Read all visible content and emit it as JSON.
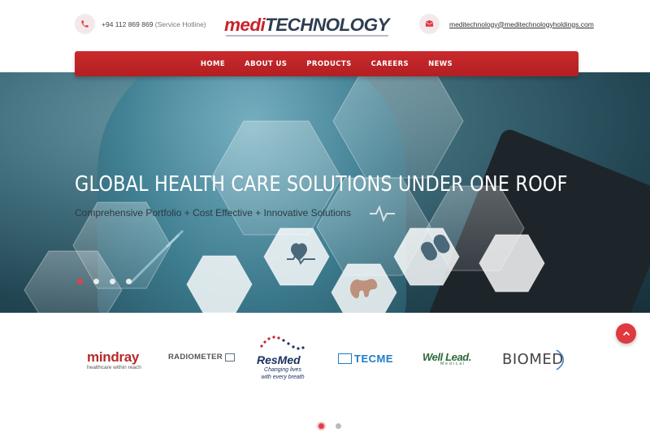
{
  "header": {
    "phone_number": "+94 112 869 869",
    "phone_note": "(Service Hotline)",
    "email": "meditechnology@meditechnologyholdings.com",
    "logo_part1": "medi",
    "logo_part2": "TECHNOLOGY"
  },
  "nav": {
    "items": [
      "HOME",
      "ABOUT US",
      "PRODUCTS",
      "CAREERS",
      "NEWS"
    ]
  },
  "hero": {
    "title": "GLOBAL HEALTH CARE SOLUTIONS UNDER ONE ROOF",
    "subtitle": "Comprehensive Portfolio + Cost Effective + Innovative Solutions",
    "slide_count": 4,
    "active_slide": 1
  },
  "brands": {
    "mindray_name": "mindray",
    "mindray_tagline": "healthcare within reach",
    "radiometer_name": "RADIOMETER",
    "resmed_name": "ResMed",
    "resmed_tagline_1": "Changing lives",
    "resmed_tagline_2": "with every breath",
    "tecme_name": "TECME",
    "welllead_name": "Well Lead.",
    "welllead_tagline": "Medical",
    "biomed_name": "BIOMED",
    "page_count": 2,
    "active_page": 1
  },
  "icons": {
    "phone": "phone-icon",
    "email": "envelope-icon",
    "scroll_top": "chevron-up-icon"
  },
  "colors": {
    "brand_red": "#c8232b",
    "logo_dark": "#2e3e51",
    "dot_active": "#e04048"
  }
}
